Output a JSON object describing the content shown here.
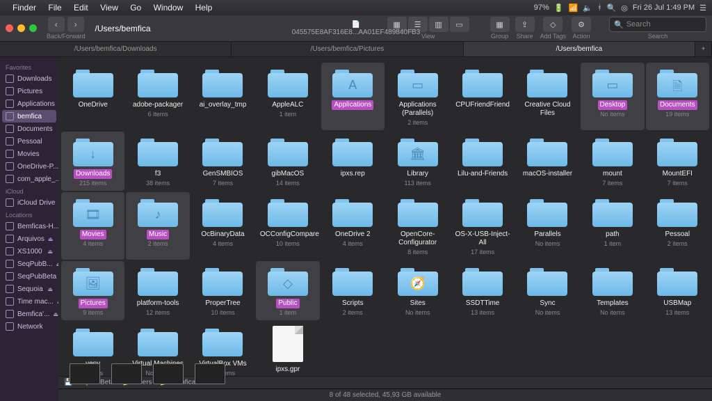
{
  "menubar": {
    "app": "Finder",
    "items": [
      "File",
      "Edit",
      "View",
      "Go",
      "Window",
      "Help"
    ],
    "right_clock": "Fri 26 Jul  1:49 PM",
    "right_batt": "97%"
  },
  "window": {
    "nav_label": "Back/Forward",
    "title": "/Users/bemfica",
    "doc_name": "045575E8AF316E8...AA01EF489840FB3",
    "view_label": "View",
    "group_label": "Group",
    "share_label": "Share",
    "addtags_label": "Add Tags",
    "action_label": "Action",
    "search_placeholder": "Search",
    "search_label": "Search"
  },
  "tabs": [
    {
      "label": "/Users/bemfica/Downloads",
      "active": false
    },
    {
      "label": "/Users/bemfica/Pictures",
      "active": false
    },
    {
      "label": "/Users/bemfica",
      "active": true
    }
  ],
  "sidebar": {
    "sections": [
      {
        "title": "Favorites",
        "items": [
          {
            "label": "Downloads"
          },
          {
            "label": "Pictures"
          },
          {
            "label": "Applications"
          },
          {
            "label": "bemfica",
            "active": true
          },
          {
            "label": "Documents"
          },
          {
            "label": "Pessoal"
          },
          {
            "label": "Movies"
          },
          {
            "label": "OneDrive-P..."
          },
          {
            "label": "com_apple_..."
          }
        ]
      },
      {
        "title": "iCloud",
        "items": [
          {
            "label": "iCloud Drive"
          }
        ]
      },
      {
        "title": "Locations",
        "items": [
          {
            "label": "Bemficas-H..."
          },
          {
            "label": "Arquivos",
            "eject": true
          },
          {
            "label": "XS1000",
            "eject": true
          },
          {
            "label": "SeqPubB...",
            "eject": true
          },
          {
            "label": "SeqPubBeta",
            "eject": true
          },
          {
            "label": "Sequoia",
            "eject": true
          },
          {
            "label": "Time mac...",
            "eject": true
          },
          {
            "label": "Bemfica'...",
            "eject": true
          },
          {
            "label": "Network"
          }
        ]
      }
    ]
  },
  "items": [
    {
      "name": "OneDrive",
      "sub": "",
      "glyph": "",
      "sel": false
    },
    {
      "name": "adobe-packager",
      "sub": "6 items",
      "glyph": "",
      "sel": false
    },
    {
      "name": "ai_overlay_tmp",
      "sub": "",
      "glyph": "",
      "sel": false
    },
    {
      "name": "AppleALC",
      "sub": "1 item",
      "glyph": "",
      "sel": false
    },
    {
      "name": "Applications",
      "sub": "",
      "glyph": "A",
      "sel": true,
      "hl": true
    },
    {
      "name": "Applications (Parallels)",
      "sub": "2 items",
      "glyph": "▭",
      "sel": false
    },
    {
      "name": "CPUFriendFriend",
      "sub": "",
      "glyph": "",
      "sel": false
    },
    {
      "name": "Creative Cloud Files",
      "sub": "",
      "glyph": "",
      "sel": false
    },
    {
      "name": "Desktop",
      "sub": "No items",
      "glyph": "▭",
      "sel": true,
      "hl": true
    },
    {
      "name": "Documents",
      "sub": "19 items",
      "glyph": "🗎",
      "sel": true,
      "hl": true
    },
    {
      "name": "Downloads",
      "sub": "215 items",
      "glyph": "↓",
      "sel": true,
      "hl": true
    },
    {
      "name": "f3",
      "sub": "38 items",
      "glyph": "",
      "sel": false
    },
    {
      "name": "GenSMBIOS",
      "sub": "7 items",
      "glyph": "",
      "sel": false
    },
    {
      "name": "gibMacOS",
      "sub": "14 items",
      "glyph": "",
      "sel": false
    },
    {
      "name": "ipxs.rep",
      "sub": "",
      "glyph": "",
      "sel": false
    },
    {
      "name": "Library",
      "sub": "113 items",
      "glyph": "🏛",
      "sel": false
    },
    {
      "name": "Lilu-and-Friends",
      "sub": "",
      "glyph": "",
      "sel": false
    },
    {
      "name": "macOS-installer",
      "sub": "",
      "glyph": "",
      "sel": false
    },
    {
      "name": "mount",
      "sub": "7 items",
      "glyph": "",
      "sel": false
    },
    {
      "name": "MountEFI",
      "sub": "7 items",
      "glyph": "",
      "sel": false
    },
    {
      "name": "Movies",
      "sub": "4 items",
      "glyph": "🎞",
      "sel": true,
      "hl": true
    },
    {
      "name": "Music",
      "sub": "2 items",
      "glyph": "♪",
      "sel": true,
      "hl": true
    },
    {
      "name": "OcBinaryData",
      "sub": "4 items",
      "glyph": "",
      "sel": false
    },
    {
      "name": "OCConfigCompare",
      "sub": "10 items",
      "glyph": "",
      "sel": false
    },
    {
      "name": "OneDrive 2",
      "sub": "4 items",
      "glyph": "",
      "sel": false
    },
    {
      "name": "OpenCore-Configurator",
      "sub": "8 items",
      "glyph": "",
      "sel": false
    },
    {
      "name": "OS-X-USB-Inject-All",
      "sub": "17 items",
      "glyph": "",
      "sel": false
    },
    {
      "name": "Parallels",
      "sub": "No items",
      "glyph": "",
      "sel": false
    },
    {
      "name": "path",
      "sub": "1 item",
      "glyph": "",
      "sel": false
    },
    {
      "name": "Pessoal",
      "sub": "2 items",
      "glyph": "",
      "sel": false
    },
    {
      "name": "Pictures",
      "sub": "9 items",
      "glyph": "🖼",
      "sel": true,
      "hl": true
    },
    {
      "name": "platform-tools",
      "sub": "12 items",
      "glyph": "",
      "sel": false
    },
    {
      "name": "ProperTree",
      "sub": "10 items",
      "glyph": "",
      "sel": false
    },
    {
      "name": "Public",
      "sub": "1 item",
      "glyph": "◇",
      "sel": true,
      "hl": true
    },
    {
      "name": "Scripts",
      "sub": "2 items",
      "glyph": "",
      "sel": false
    },
    {
      "name": "Sites",
      "sub": "No items",
      "glyph": "🧭",
      "sel": false
    },
    {
      "name": "SSDTTime",
      "sub": "13 items",
      "glyph": "",
      "sel": false
    },
    {
      "name": "Sync",
      "sub": "No items",
      "glyph": "",
      "sel": false
    },
    {
      "name": "Templates",
      "sub": "No items",
      "glyph": "",
      "sel": false
    },
    {
      "name": "USBMap",
      "sub": "13 items",
      "glyph": "",
      "sel": false
    },
    {
      "name": "venv",
      "sub": "4 items",
      "glyph": "",
      "sel": false
    },
    {
      "name": "Virtual Machines",
      "sub": "No items",
      "glyph": "",
      "sel": false
    },
    {
      "name": "VirtualBox VMs",
      "sub": "No items",
      "glyph": "",
      "sel": false
    },
    {
      "name": "ipxs.gpr",
      "sub": "",
      "glyph": "",
      "sel": false,
      "file": true
    }
  ],
  "pathbar": [
    "SeqPubBeta",
    "Users",
    "bemfica"
  ],
  "status": "8 of 48 selected, 45,93 GB available"
}
